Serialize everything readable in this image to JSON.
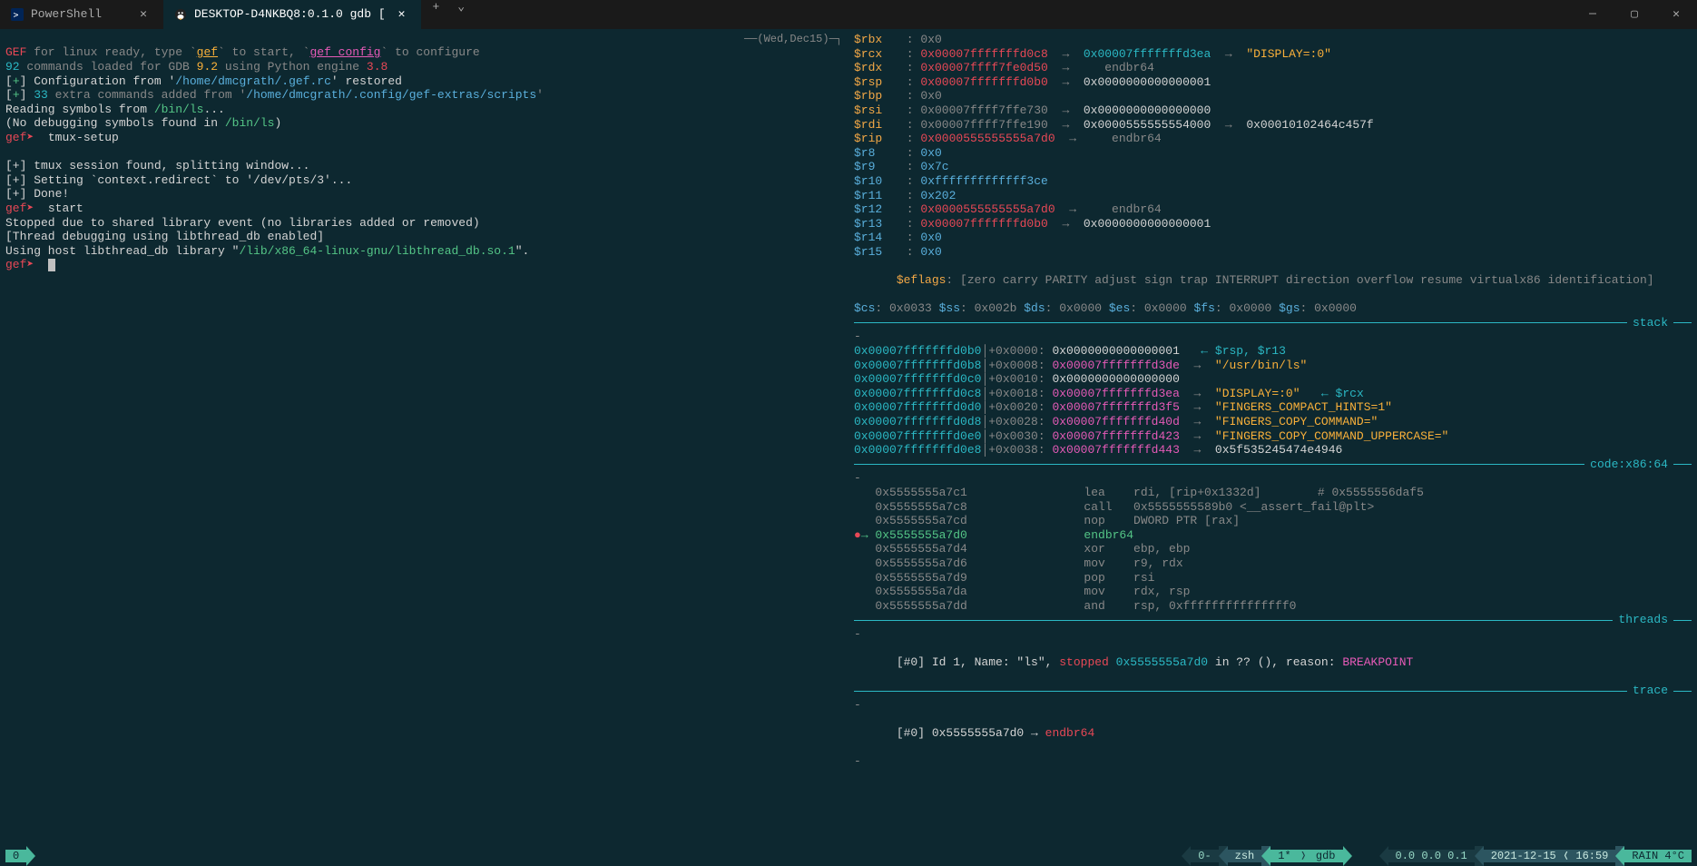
{
  "titlebar": {
    "tabs": [
      {
        "icon": "powershell-icon",
        "label": "PowerShell",
        "active": false
      },
      {
        "icon": "tux-icon",
        "label": "DESKTOP-D4NKBQ8:0.1.0 gdb [",
        "active": true
      }
    ]
  },
  "date_header": "──(Wed,Dec15)─┐",
  "left_pane": {
    "lines": [
      {
        "segments": [
          {
            "t": "GEF",
            "c": "red"
          },
          {
            "t": " for linux ready, type `",
            "c": "gray"
          },
          {
            "t": "gef",
            "c": "yellow",
            "u": true
          },
          {
            "t": "` to start, `",
            "c": "gray"
          },
          {
            "t": "gef config",
            "c": "magenta",
            "u": true
          },
          {
            "t": "` to configure",
            "c": "gray"
          }
        ]
      },
      {
        "segments": [
          {
            "t": "92",
            "c": "cyan"
          },
          {
            "t": " commands loaded for GDB ",
            "c": "gray"
          },
          {
            "t": "9.2",
            "c": "yellow"
          },
          {
            "t": " using Python engine ",
            "c": "gray"
          },
          {
            "t": "3.8",
            "c": "red"
          }
        ]
      },
      {
        "segments": [
          {
            "t": "[",
            "c": "white"
          },
          {
            "t": "+",
            "c": "green"
          },
          {
            "t": "] Configuration from '",
            "c": "white"
          },
          {
            "t": "/home/dmcgrath/.gef.rc",
            "c": "blue"
          },
          {
            "t": "' restored",
            "c": "white"
          }
        ]
      },
      {
        "segments": [
          {
            "t": "[",
            "c": "white"
          },
          {
            "t": "+",
            "c": "green"
          },
          {
            "t": "] ",
            "c": "white"
          },
          {
            "t": "33",
            "c": "cyan"
          },
          {
            "t": " extra commands added from '",
            "c": "gray"
          },
          {
            "t": "/home/dmcgrath/.config/gef-extras/scripts",
            "c": "blue"
          },
          {
            "t": "'",
            "c": "gray"
          }
        ]
      },
      {
        "segments": [
          {
            "t": "Reading symbols from ",
            "c": "white"
          },
          {
            "t": "/bin/ls",
            "c": "green"
          },
          {
            "t": "...",
            "c": "white"
          }
        ]
      },
      {
        "segments": [
          {
            "t": "(No debugging symbols found in ",
            "c": "white"
          },
          {
            "t": "/bin/ls",
            "c": "green"
          },
          {
            "t": ")",
            "c": "white"
          }
        ]
      },
      {
        "segments": [
          {
            "t": "gef➤  ",
            "c": "red"
          },
          {
            "t": "tmux-setup",
            "c": "white"
          }
        ]
      },
      {
        "segments": []
      },
      {
        "segments": [
          {
            "t": "[+] tmux session found, splitting window...",
            "c": "white"
          }
        ]
      },
      {
        "segments": [
          {
            "t": "[+] Setting `context.redirect` to '/dev/pts/3'...",
            "c": "white"
          }
        ]
      },
      {
        "segments": [
          {
            "t": "[+] Done!",
            "c": "white"
          }
        ]
      },
      {
        "segments": [
          {
            "t": "gef➤  ",
            "c": "red"
          },
          {
            "t": "start",
            "c": "white"
          }
        ]
      },
      {
        "segments": [
          {
            "t": "Stopped due to shared library event (no libraries added or removed)",
            "c": "white"
          }
        ]
      },
      {
        "segments": [
          {
            "t": "[Thread debugging using libthread_db enabled]",
            "c": "white"
          }
        ]
      },
      {
        "segments": [
          {
            "t": "Using host libthread_db library \"",
            "c": "white"
          },
          {
            "t": "/lib/x86_64-linux-gnu/libthread_db.so.1",
            "c": "green"
          },
          {
            "t": "\".",
            "c": "white"
          }
        ]
      },
      {
        "segments": [
          {
            "t": "gef➤  ",
            "c": "red"
          }
        ],
        "cursor": true
      }
    ]
  },
  "registers": [
    {
      "name": "$rbx",
      "val": "0x0",
      "c": "gray"
    },
    {
      "name": "$rcx",
      "val": "0x00007fffffffd0c8",
      "c": "red",
      "arrow": "0x00007fffffffd3ea",
      "ac": "cyan",
      "arrow2": "\"DISPLAY=:0\"",
      "a2c": "yellow"
    },
    {
      "name": "$rdx",
      "val": "0x00007ffff7fe0d50",
      "c": "red",
      "arrow": "   endbr64",
      "ac": "gray"
    },
    {
      "name": "$rsp",
      "val": "0x00007fffffffd0b0",
      "c": "red",
      "arrow": "0x0000000000000001",
      "ac": "white"
    },
    {
      "name": "$rbp",
      "val": "0x0",
      "c": "gray"
    },
    {
      "name": "$rsi",
      "val": "0x00007ffff7ffe730",
      "c": "gray",
      "arrow": "0x0000000000000000",
      "ac": "white"
    },
    {
      "name": "$rdi",
      "val": "0x00007ffff7ffe190",
      "c": "gray",
      "arrow": "0x0000555555554000",
      "ac": "white",
      "arrow2": "0x00010102464c457f",
      "a2c": "white"
    },
    {
      "name": "$rip",
      "val": "0x0000555555555a7d0",
      "c": "red",
      "arrow": "   endbr64",
      "ac": "gray"
    },
    {
      "name": "$r8",
      "val": "0x0",
      "c": "blue",
      "vc": "gray"
    },
    {
      "name": "$r9",
      "val": "0x7c",
      "c": "blue",
      "vc": "gray"
    },
    {
      "name": "$r10",
      "val": "0xfffffffffffff3ce",
      "c": "blue",
      "vc": "gray"
    },
    {
      "name": "$r11",
      "val": "0x202",
      "c": "blue",
      "vc": "gray"
    },
    {
      "name": "$r12",
      "val": "0x0000555555555a7d0",
      "c": "red",
      "arrow": "   endbr64",
      "ac": "gray"
    },
    {
      "name": "$r13",
      "val": "0x00007fffffffd0b0",
      "c": "red",
      "arrow": "0x0000000000000001",
      "ac": "white"
    },
    {
      "name": "$r14",
      "val": "0x0",
      "c": "blue",
      "vc": "gray"
    },
    {
      "name": "$r15",
      "val": "0x0",
      "c": "blue",
      "vc": "gray"
    }
  ],
  "eflags": {
    "label": "$eflags",
    "value": "[zero carry PARITY adjust sign trap INTERRUPT direction overflow resume virtualx86 identification]"
  },
  "segments": [
    {
      "n": "$cs",
      "v": "0x0033"
    },
    {
      "n": "$ss",
      "v": "0x002b"
    },
    {
      "n": "$ds",
      "v": "0x0000"
    },
    {
      "n": "$es",
      "v": "0x0000"
    },
    {
      "n": "$fs",
      "v": "0x0000"
    },
    {
      "n": "$gs",
      "v": "0x0000"
    }
  ],
  "sections": {
    "stack": "stack",
    "code": "code:x86:64",
    "threads": "threads",
    "trace": "trace"
  },
  "stack": [
    {
      "addr": "0x00007fffffffd0b0",
      "off": "+0x0000:",
      "val": "0x0000000000000001",
      "note": "← $rsp, $r13",
      "nc": "cyan"
    },
    {
      "addr": "0x00007fffffffd0b8",
      "off": "+0x0008:",
      "val": "0x00007fffffffd3de",
      "vc": "magenta",
      "arrow": "\"/usr/bin/ls\"",
      "ac": "yellow"
    },
    {
      "addr": "0x00007fffffffd0c0",
      "off": "+0x0010:",
      "val": "0x0000000000000000"
    },
    {
      "addr": "0x00007fffffffd0c8",
      "off": "+0x0018:",
      "val": "0x00007fffffffd3ea",
      "vc": "magenta",
      "arrow": "\"DISPLAY=:0\"",
      "ac": "yellow",
      "note": "← $rcx",
      "nc": "cyan"
    },
    {
      "addr": "0x00007fffffffd0d0",
      "off": "+0x0020:",
      "val": "0x00007fffffffd3f5",
      "vc": "magenta",
      "arrow": "\"FINGERS_COMPACT_HINTS=1\"",
      "ac": "yellow"
    },
    {
      "addr": "0x00007fffffffd0d8",
      "off": "+0x0028:",
      "val": "0x00007fffffffd40d",
      "vc": "magenta",
      "arrow": "\"FINGERS_COPY_COMMAND=\"",
      "ac": "yellow"
    },
    {
      "addr": "0x00007fffffffd0e0",
      "off": "+0x0030:",
      "val": "0x00007fffffffd423",
      "vc": "magenta",
      "arrow": "\"FINGERS_COPY_COMMAND_UPPERCASE=\"",
      "ac": "yellow"
    },
    {
      "addr": "0x00007fffffffd0e8",
      "off": "+0x0038:",
      "val": "0x00007fffffffd443",
      "vc": "magenta",
      "arrow": "0x5f535245474e4946",
      "ac": "white"
    }
  ],
  "code": [
    {
      "addr": "0x5555555a7c1",
      "instr": "lea    rdi, [rip+0x1332d]        # 0x5555556daf5",
      "c": "gray"
    },
    {
      "addr": "0x5555555a7c8",
      "instr": "call   0x5555555589b0 <__assert_fail@plt>",
      "c": "gray"
    },
    {
      "addr": "0x5555555a7cd",
      "instr": "nop    DWORD PTR [rax]",
      "c": "gray"
    },
    {
      "addr": "0x5555555a7d0",
      "instr": "endbr64",
      "c": "green",
      "bp": true,
      "current": true
    },
    {
      "addr": "0x5555555a7d4",
      "instr": "xor    ebp, ebp",
      "c": "gray"
    },
    {
      "addr": "0x5555555a7d6",
      "instr": "mov    r9, rdx",
      "c": "gray"
    },
    {
      "addr": "0x5555555a7d9",
      "instr": "pop    rsi",
      "c": "gray"
    },
    {
      "addr": "0x5555555a7da",
      "instr": "mov    rdx, rsp",
      "c": "gray"
    },
    {
      "addr": "0x5555555a7dd",
      "instr": "and    rsp, 0xfffffffffffffff0",
      "c": "gray"
    }
  ],
  "threads": {
    "text_pre": "[#0] Id 1, Name: \"ls\", ",
    "stopped": "stopped",
    "addr": "0x5555555a7d0",
    "post": " in ?? (), reason: ",
    "reason": "BREAKPOINT"
  },
  "trace": {
    "pre": "[#0] 0x5555555a7d0 → ",
    "instr": "endbr64"
  },
  "statusbar": {
    "left": "0",
    "right": {
      "session": "0-",
      "shell": "zsh",
      "window": "1*",
      "app": "gdb",
      "load": "0.0 0.0 0.1",
      "datetime": "2021-12-15 ❬ 16:59",
      "weather": "RAIN 4°C"
    }
  }
}
